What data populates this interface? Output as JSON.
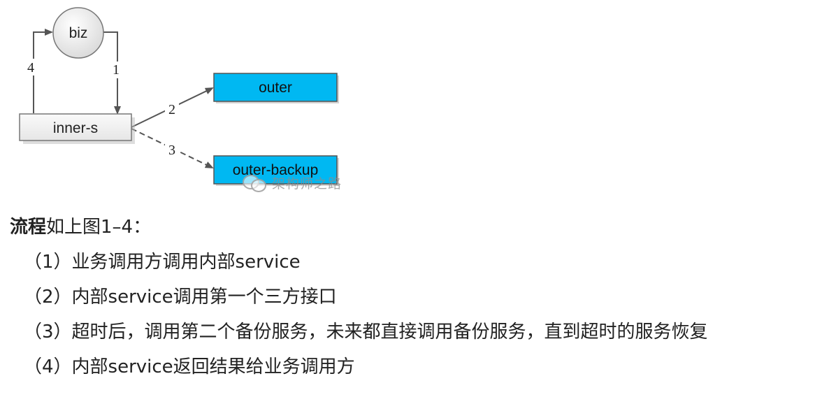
{
  "diagram": {
    "nodes": {
      "biz": "biz",
      "inner": "inner-s",
      "outer": "outer",
      "backup": "outer-backup"
    },
    "edge_labels": {
      "e1": "1",
      "e2": "2",
      "e3": "3",
      "e4": "4"
    },
    "colors": {
      "outer_fill": "#00b8f2",
      "node_border": "#555555",
      "inner_fill": "#f2f2f2",
      "arrow": "#555555"
    }
  },
  "watermark": {
    "text": "架构师之路"
  },
  "text": {
    "heading_bold": "流程",
    "heading_rest": "如上图1–4：",
    "steps": [
      "（1）业务调用方调用内部service",
      "（2）内部service调用第一个三方接口",
      "（3）超时后，调用第二个备份服务，未来都直接调用备份服务，直到超时的服务恢复",
      "（4）内部service返回结果给业务调用方"
    ]
  }
}
